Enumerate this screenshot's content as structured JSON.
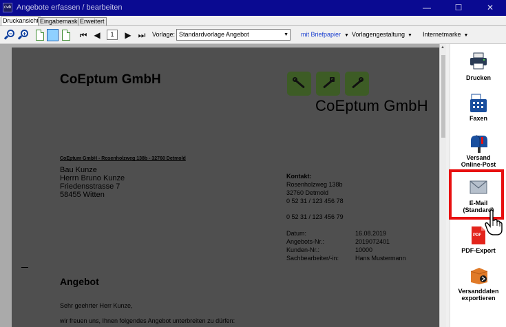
{
  "window": {
    "title": "Angebote erfassen / bearbeiten",
    "icon_text": "cwb",
    "minimize_glyph": "—",
    "maximize_glyph": "☐",
    "close_glyph": "✕"
  },
  "tabs": [
    {
      "label": "Druckansicht",
      "active": true
    },
    {
      "label": "Eingabemaske",
      "active": false
    },
    {
      "label": "Erweitert",
      "active": false
    }
  ],
  "toolbar": {
    "zoom_out_glyph": "−",
    "zoom_in_glyph": "+",
    "first_glyph": "⏮",
    "prev_glyph": "◀",
    "page_number": "1",
    "next_glyph": "▶",
    "last_glyph": "⏭",
    "vorlage_label": "Vorlage:",
    "vorlage_value": "Standardvorlage Angebot",
    "select_arrow": "▼",
    "briefpapier": "mit Briefpapier",
    "vorlagengestaltung": "Vorlagengestaltung",
    "internetmarke": "Internetmarke",
    "caret": "▼"
  },
  "document": {
    "company": "CoEptum GmbH",
    "logo_text": "CoEptum GmbH",
    "sender_line": "CoEptum GmbH - Rosenholzweg 138b - 32760 Detmold",
    "recipient": [
      "Bau Kunze",
      "Herrn Bruno Kunze",
      "Friedensstrasse 7",
      "58455 Witten"
    ],
    "kontakt_heading": "Kontakt:",
    "kontakt_lines": [
      "Rosenholzweg 138b",
      "32760 Detmold",
      "0 52 31 / 123 456 78",
      "0 52 31 / 123 456 79"
    ],
    "meta": [
      {
        "label": "Datum:",
        "value": "16.08.2019"
      },
      {
        "label": "Angebots-Nr.:",
        "value": "2019072401"
      },
      {
        "label": "Kunden-Nr.:",
        "value": "10000"
      },
      {
        "label": "Sachbearbeiter/-in:",
        "value": "Hans Mustermann"
      }
    ],
    "heading": "Angebot",
    "salutation": "Sehr geehrter Herr Kunze,",
    "intro": "wir freuen uns, Ihnen folgendes Angebot unterbreiten zu dürfen:"
  },
  "colors": {
    "titlebar": "#0a0a91",
    "accent_blue": "#0e3f9e",
    "logo_green": "#3d5c25",
    "highlight_red": "#e81010",
    "briefpapier_link": "#1a3fd0"
  },
  "actions": [
    {
      "icon": "printer-icon",
      "label": "Drucken"
    },
    {
      "icon": "fax-icon",
      "label": "Faxen"
    },
    {
      "icon": "mailbox-icon",
      "label": "Versand Online-Post"
    },
    {
      "icon": "envelope-icon",
      "label": "E-Mail (Standard)"
    },
    {
      "icon": "pdf-icon",
      "label": "PDF-Export",
      "badge": "PDF"
    },
    {
      "icon": "export-box-icon",
      "label": "Versanddaten exportieren"
    }
  ]
}
